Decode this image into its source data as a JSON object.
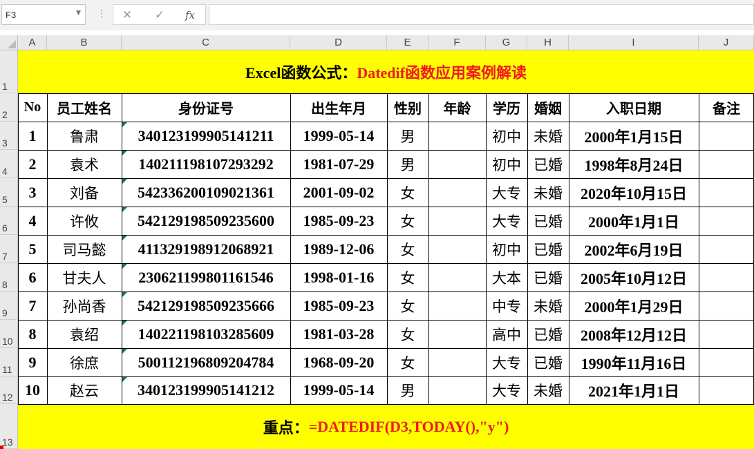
{
  "formula_bar": {
    "name_box": "F3",
    "cancel_icon": "✕",
    "enter_icon": "✓",
    "fx_label": "fx",
    "formula": ""
  },
  "columns": [
    "A",
    "B",
    "C",
    "D",
    "E",
    "F",
    "G",
    "H",
    "I",
    "J"
  ],
  "rows": [
    "1",
    "2",
    "3",
    "4",
    "5",
    "6",
    "7",
    "8",
    "9",
    "10",
    "11",
    "12",
    "13"
  ],
  "title": {
    "black_part": "Excel函数公式：",
    "red_part": "Datedif函数应用案例解读"
  },
  "table": {
    "headers": [
      "No",
      "员工姓名",
      "身份证号",
      "出生年月",
      "性别",
      "年龄",
      "学历",
      "婚姻",
      "入职日期",
      "备注"
    ],
    "records": [
      [
        "1",
        "鲁肃",
        "340123199905141211",
        "1999-05-14",
        "男",
        "",
        "初中",
        "未婚",
        "2000年1月15日",
        ""
      ],
      [
        "2",
        "袁术",
        "140211198107293292",
        "1981-07-29",
        "男",
        "",
        "初中",
        "已婚",
        "1998年8月24日",
        ""
      ],
      [
        "3",
        "刘备",
        "542336200109021361",
        "2001-09-02",
        "女",
        "",
        "大专",
        "未婚",
        "2020年10月15日",
        ""
      ],
      [
        "4",
        "许攸",
        "542129198509235600",
        "1985-09-23",
        "女",
        "",
        "大专",
        "已婚",
        "2000年1月1日",
        ""
      ],
      [
        "5",
        "司马懿",
        "411329198912068921",
        "1989-12-06",
        "女",
        "",
        "初中",
        "已婚",
        "2002年6月19日",
        ""
      ],
      [
        "6",
        "甘夫人",
        "230621199801161546",
        "1998-01-16",
        "女",
        "",
        "大本",
        "已婚",
        "2005年10月12日",
        ""
      ],
      [
        "7",
        "孙尚香",
        "542129198509235666",
        "1985-09-23",
        "女",
        "",
        "中专",
        "未婚",
        "2000年1月29日",
        ""
      ],
      [
        "8",
        "袁绍",
        "140221198103285609",
        "1981-03-28",
        "女",
        "",
        "高中",
        "已婚",
        "2008年12月12日",
        ""
      ],
      [
        "9",
        "徐庶",
        "500112196809204784",
        "1968-09-20",
        "女",
        "",
        "大专",
        "已婚",
        "1990年11月16日",
        ""
      ],
      [
        "10",
        "赵云",
        "340123199905141212",
        "1999-05-14",
        "男",
        "",
        "大专",
        "未婚",
        "2021年1月1日",
        ""
      ]
    ]
  },
  "footer": {
    "black_part": "重点：",
    "red_part": "=DATEDIF(D3,TODAY(),\"y\")"
  },
  "colors": {
    "band": "#ffff00",
    "accent_red": "#ee1c1c",
    "text_marker": "#1f7a3a"
  }
}
